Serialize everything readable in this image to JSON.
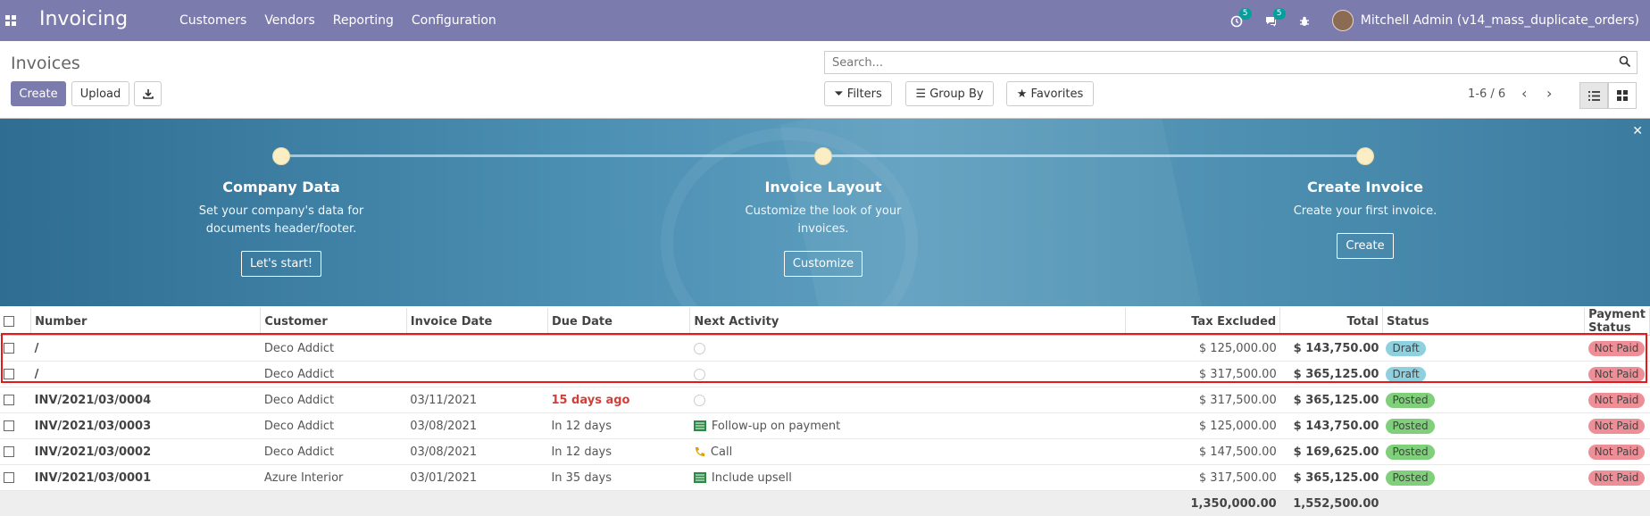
{
  "navbar": {
    "app_title": "Invoicing",
    "menu": [
      "Customers",
      "Vendors",
      "Reporting",
      "Configuration"
    ],
    "activity_count": "5",
    "messages_count": "5",
    "user": "Mitchell Admin (v14_mass_duplicate_orders)"
  },
  "control_panel": {
    "breadcrumb": "Invoices",
    "create_label": "Create",
    "upload_label": "Upload",
    "search_placeholder": "Search...",
    "filters_label": "Filters",
    "groupby_label": "Group By",
    "favorites_label": "Favorites",
    "pager": "1-6 / 6"
  },
  "banner": {
    "steps": [
      {
        "title": "Company Data",
        "desc": "Set your company's data for documents header/footer.",
        "button": "Let's start!"
      },
      {
        "title": "Invoice Layout",
        "desc": "Customize the look of your invoices.",
        "button": "Customize"
      },
      {
        "title": "Create Invoice",
        "desc": "Create your first invoice.",
        "button": "Create"
      }
    ]
  },
  "table": {
    "columns": [
      "Number",
      "Customer",
      "Invoice Date",
      "Due Date",
      "Next Activity",
      "Tax Excluded",
      "Total",
      "Status",
      "Payment Status"
    ],
    "rows": [
      {
        "number": "/",
        "customer": "Deco Addict",
        "invoice_date": "",
        "due_date": "",
        "activity": "",
        "tax_excluded": "$ 125,000.00",
        "total": "$ 143,750.00",
        "status": "Draft",
        "payment": "Not Paid"
      },
      {
        "number": "/",
        "customer": "Deco Addict",
        "invoice_date": "",
        "due_date": "",
        "activity": "",
        "tax_excluded": "$ 317,500.00",
        "total": "$ 365,125.00",
        "status": "Draft",
        "payment": "Not Paid"
      },
      {
        "number": "INV/2021/03/0004",
        "customer": "Deco Addict",
        "invoice_date": "03/11/2021",
        "due_date": "15 days ago",
        "activity": "",
        "tax_excluded": "$ 317,500.00",
        "total": "$ 365,125.00",
        "status": "Posted",
        "payment": "Not Paid"
      },
      {
        "number": "INV/2021/03/0003",
        "customer": "Deco Addict",
        "invoice_date": "03/08/2021",
        "due_date": "In 12 days",
        "activity": "Follow-up on payment",
        "tax_excluded": "$ 125,000.00",
        "total": "$ 143,750.00",
        "status": "Posted",
        "payment": "Not Paid"
      },
      {
        "number": "INV/2021/03/0002",
        "customer": "Deco Addict",
        "invoice_date": "03/08/2021",
        "due_date": "In 12 days",
        "activity": "Call",
        "tax_excluded": "$ 147,500.00",
        "total": "$ 169,625.00",
        "status": "Posted",
        "payment": "Not Paid"
      },
      {
        "number": "INV/2021/03/0001",
        "customer": "Azure Interior",
        "invoice_date": "03/01/2021",
        "due_date": "In 35 days",
        "activity": "Include upsell",
        "tax_excluded": "$ 317,500.00",
        "total": "$ 365,125.00",
        "status": "Posted",
        "payment": "Not Paid"
      }
    ],
    "totals": {
      "tax_excluded": "1,350,000.00",
      "total": "1,552,500.00"
    }
  }
}
